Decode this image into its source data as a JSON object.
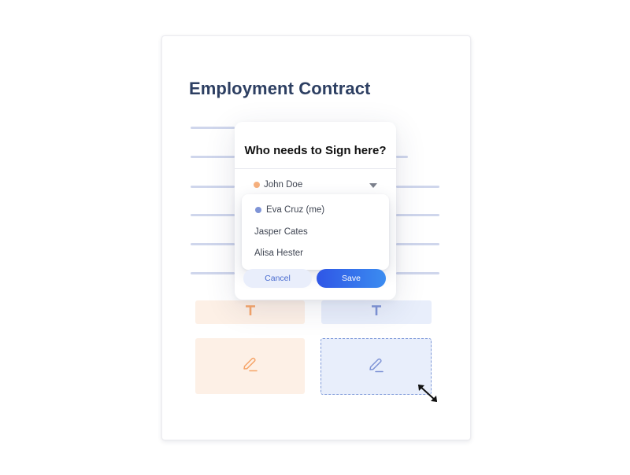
{
  "document": {
    "title": "Employment Contract"
  },
  "modal": {
    "title": "Who needs to Sign here?",
    "selected_signer": {
      "name": "John Doe",
      "color": "#f6b07e"
    },
    "options": [
      {
        "name": "Eva Cruz (me)",
        "color": "#7f94d6"
      },
      {
        "name": "Jasper Cates"
      },
      {
        "name": "Alisa Hester"
      }
    ],
    "cancel_label": "Cancel",
    "save_label": "Save"
  },
  "fields": {
    "text_field_icon": "text-T-icon",
    "signature_field_icon": "pen-signature-icon",
    "resize_icon": "resize-diagonal-icon"
  },
  "colors": {
    "orange_signer": "#f6a56a",
    "blue_signer": "#7f94d6",
    "title": "#2d3f62",
    "primary": "#2f56e6"
  }
}
